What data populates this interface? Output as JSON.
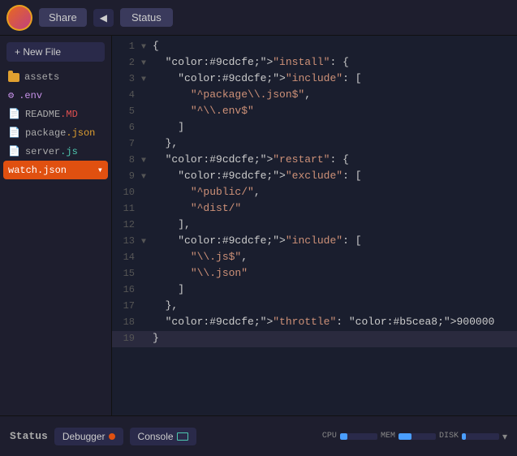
{
  "topbar": {
    "share_label": "Share",
    "back_label": "◀",
    "status_label": "Status"
  },
  "sidebar": {
    "new_file_label": "+ New File",
    "items": [
      {
        "id": "assets",
        "label": "assets",
        "type": "folder"
      },
      {
        "id": "env",
        "label": ".env",
        "type": "env"
      },
      {
        "id": "readme",
        "label": "README",
        "ext": ".MD",
        "type": "md"
      },
      {
        "id": "package-json",
        "label": "package",
        "ext": ".json",
        "type": "json"
      },
      {
        "id": "server-js",
        "label": "server",
        "ext": ".js",
        "type": "js"
      },
      {
        "id": "watch-json",
        "label": "watch.json",
        "type": "active"
      }
    ]
  },
  "editor": {
    "filename": "watch.json",
    "lines": [
      {
        "num": 1,
        "arrow": "▼",
        "code": "{",
        "highlight": false
      },
      {
        "num": 2,
        "arrow": "▼",
        "code": "  \"install\": {",
        "highlight": false
      },
      {
        "num": 3,
        "arrow": "▼",
        "code": "    \"include\": [",
        "highlight": false
      },
      {
        "num": 4,
        "arrow": " ",
        "code": "      \"^package\\\\.json$\",",
        "highlight": false
      },
      {
        "num": 5,
        "arrow": " ",
        "code": "      \"^\\\\.env$\"",
        "highlight": false
      },
      {
        "num": 6,
        "arrow": " ",
        "code": "    ]",
        "highlight": false
      },
      {
        "num": 7,
        "arrow": " ",
        "code": "  },",
        "highlight": false
      },
      {
        "num": 8,
        "arrow": "▼",
        "code": "  \"restart\": {",
        "highlight": false
      },
      {
        "num": 9,
        "arrow": "▼",
        "code": "    \"exclude\": [",
        "highlight": false
      },
      {
        "num": 10,
        "arrow": " ",
        "code": "      \"^public/\",",
        "highlight": false
      },
      {
        "num": 11,
        "arrow": " ",
        "code": "      \"^dist/\"",
        "highlight": false
      },
      {
        "num": 12,
        "arrow": " ",
        "code": "    ],",
        "highlight": false
      },
      {
        "num": 13,
        "arrow": "▼",
        "code": "    \"include\": [",
        "highlight": false
      },
      {
        "num": 14,
        "arrow": " ",
        "code": "      \"\\\\.js$\",",
        "highlight": false
      },
      {
        "num": 15,
        "arrow": " ",
        "code": "      \"\\\\.json\"",
        "highlight": false
      },
      {
        "num": 16,
        "arrow": " ",
        "code": "    ]",
        "highlight": false
      },
      {
        "num": 17,
        "arrow": " ",
        "code": "  },",
        "highlight": false
      },
      {
        "num": 18,
        "arrow": " ",
        "code": "  \"throttle\": 900000",
        "highlight": false
      },
      {
        "num": 19,
        "arrow": " ",
        "code": "}",
        "highlight": true
      }
    ]
  },
  "bottombar": {
    "status_label": "Status",
    "debugger_label": "Debugger",
    "console_label": "Console",
    "cpu_label": "CPU",
    "mem_label": "MEM",
    "disk_label": "DISK"
  }
}
